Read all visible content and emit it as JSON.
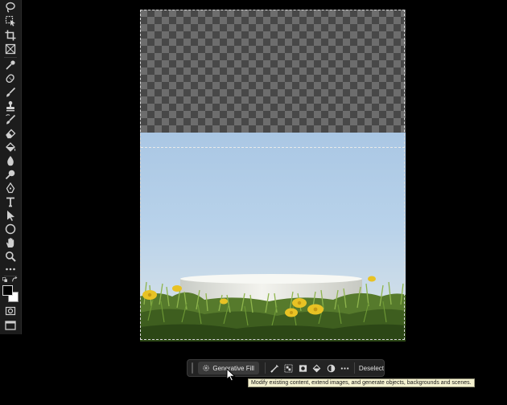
{
  "taskbar": {
    "generative_fill_label": "Generative Fill",
    "deselect_label": "Deselect",
    "tooltip": "Modify existing content, extend images, and generate objects, backgrounds and scenes."
  },
  "toolbar": {
    "tools": [
      "lasso-icon",
      "object-selection-icon",
      "crop-icon",
      "frame-icon",
      "eyedropper-icon",
      "spot-healing-icon",
      "brush-icon",
      "clone-stamp-icon",
      "history-brush-icon",
      "eraser-icon",
      "paint-bucket-icon",
      "blur-icon",
      "dodge-icon",
      "pen-icon",
      "type-icon",
      "path-selection-icon",
      "ellipse-icon",
      "hand-icon",
      "zoom-icon",
      "more-tools-icon"
    ],
    "foreground_color": "#000000",
    "background_color": "#ffffff"
  },
  "colors": {
    "app_background": "#000000",
    "toolbar_background": "#1c1c1c",
    "tooltip_background": "#f4f1cf"
  }
}
